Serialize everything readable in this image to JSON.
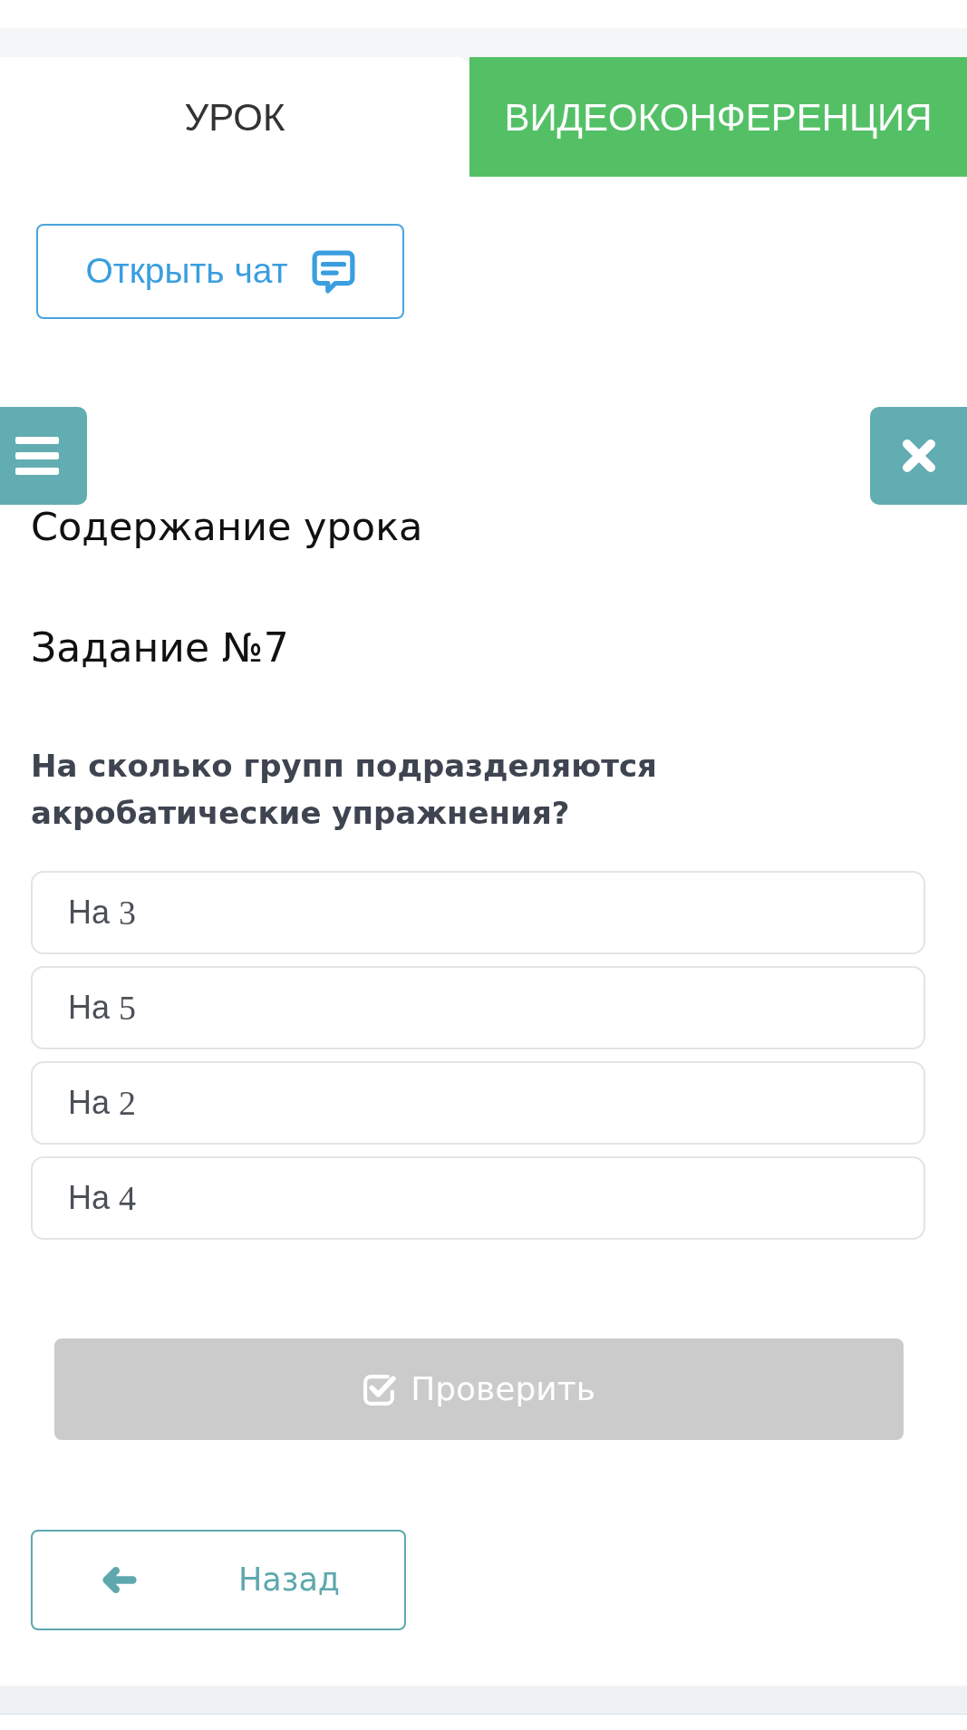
{
  "tabs": [
    {
      "label": "УРОК",
      "selected": true
    },
    {
      "label": "ВИДЕОКОНФЕРЕНЦИЯ",
      "selected": false
    }
  ],
  "chat_button": {
    "label": "Открыть чат"
  },
  "lesson_contents": {
    "title": "Содержание урока"
  },
  "task": {
    "title": "Задание №7",
    "question": "На сколько групп подразделяются акробатические упражнения?",
    "options": [
      {
        "text": "На",
        "math": "3",
        "selected": false
      },
      {
        "text": "На",
        "math": "5",
        "selected": false
      },
      {
        "text": "На",
        "math": "2",
        "selected": false
      },
      {
        "text": "На",
        "math": "4",
        "selected": false
      }
    ]
  },
  "check_button": {
    "label": "Проверить",
    "disabled": true
  },
  "back_button": {
    "label": "Назад"
  }
}
